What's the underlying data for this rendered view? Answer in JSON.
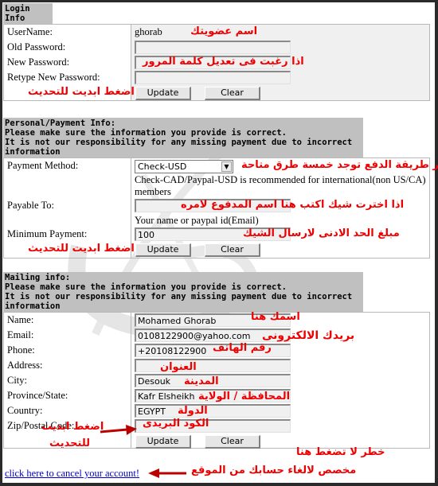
{
  "login": {
    "header": "Login Info",
    "labels": {
      "username": "UserName:",
      "old_password": "Old Password:",
      "new_password": "New Password:",
      "retype_password": "Retype New Password:"
    },
    "values": {
      "username": "ghorab",
      "old_password": "",
      "new_password": "",
      "retype_password": ""
    },
    "update_label": "Update",
    "clear_label": "Clear",
    "annotations": {
      "username": "اسم عضويتك",
      "new_password": "اذا رغبت فى تعديل كلمة المرور",
      "update": "اضغط ابديت للتحديث"
    }
  },
  "payment": {
    "header_title": "Personal/Payment Info:",
    "header_line1": "Please make sure the information you provide is correct.",
    "header_line2": "It is not our responsibility for any missing payment due to incorrect information",
    "labels": {
      "method": "Payment Method:",
      "payable_to": "Payable To:",
      "minimum": "Minimum Payment:"
    },
    "method_selected": "Check-USD",
    "method_note": "Check-CAD/Paypal-USD is recommended for international(non US/CA) members",
    "payable_to_value": "",
    "payable_to_note": "Your name or paypal id(Email)",
    "minimum_value": "100",
    "update_label": "Update",
    "clear_label": "Clear",
    "annotations": {
      "method": "اختر طريقة الدفع توجد خمسة طرق متاحة",
      "payable_to": "اذا اخترت شيك اكتب هنا اسم المدفوع لامره",
      "minimum": "مبلغ الحد الادنى لارسال الشيك",
      "update": "اضغط ابديت للتحديث"
    }
  },
  "mailing": {
    "header_title": "Mailing info:",
    "header_line1": "Please make sure the information you provide is correct.",
    "header_line2": "It is not our responsibility for any missing payment due to incorrect information",
    "labels": {
      "name": "Name:",
      "email": "Email:",
      "phone": "Phone:",
      "address": "Address:",
      "city": "City:",
      "province": "Province/State:",
      "country": "Country:",
      "zip": "Zip/Postal Code:"
    },
    "values": {
      "name": "Mohamed Ghorab",
      "email": "0108122900@yahoo.com",
      "phone": "+20108122900",
      "address": "",
      "city": "Desouk",
      "province": "Kafr Elsheikh",
      "country": "EGYPT",
      "zip": ""
    },
    "update_label": "Update",
    "clear_label": "Clear",
    "annotations": {
      "name": "اسمك هنا",
      "email": "بريدك الالكترونى",
      "phone": "رقم الهاتف",
      "address": "العنوان",
      "city": "المدينة",
      "province": "المحافظة / الولاية",
      "country": "الدولة",
      "zip": "الكود البريدى",
      "update_line1": "اضغط ابديت",
      "update_line2": "للتحديث"
    }
  },
  "cancel": {
    "link_text": "click here to cancel your account!",
    "warning_line1": "خطر لا تضغط هنا",
    "warning_line2": "مخصص لالغاء حسابك من الموقع"
  },
  "colors": {
    "annotation": "#ee0000",
    "header_bg": "#c0c0c0",
    "link": "#0000cc"
  }
}
